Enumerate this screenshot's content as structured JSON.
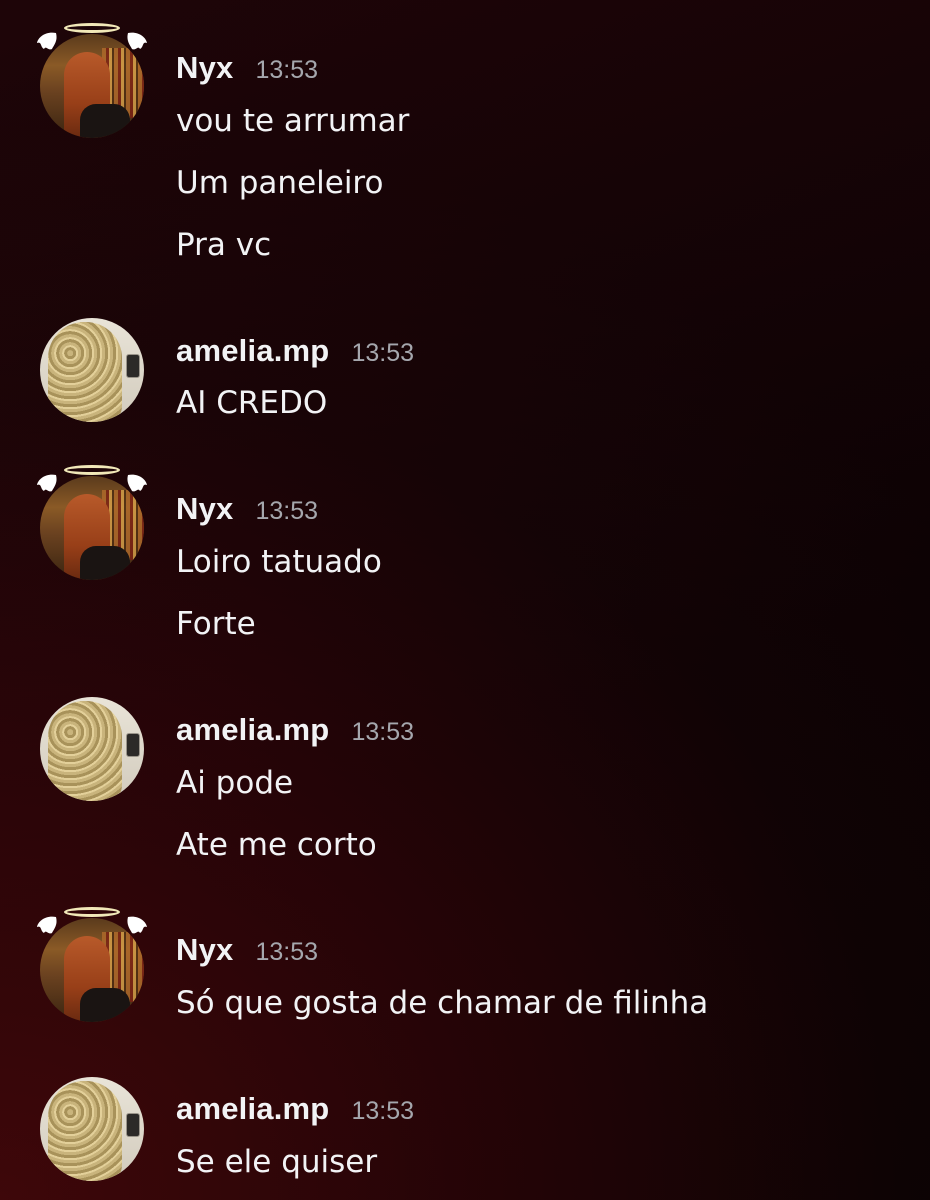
{
  "messages": [
    {
      "username": "Nyx",
      "time": "13:53",
      "lines": [
        "vou te arrumar",
        "Um paneleiro",
        "Pra vc"
      ]
    },
    {
      "username": "amelia.mp",
      "time": "13:53",
      "lines": [
        "AI CREDO"
      ]
    },
    {
      "username": "Nyx",
      "time": "13:53",
      "lines": [
        "Loiro tatuado",
        "Forte"
      ]
    },
    {
      "username": "amelia.mp",
      "time": "13:53",
      "lines": [
        "Ai pode",
        "Ate me corto"
      ]
    },
    {
      "username": "Nyx",
      "time": "13:53",
      "lines": [
        "Só que gosta de chamar de filinha"
      ]
    },
    {
      "username": "amelia.mp",
      "time": "13:53",
      "lines": [
        "Se ele quiser"
      ]
    }
  ],
  "colors": {
    "text": "#f2f3f5",
    "timestamp": "#a5a7ad",
    "background_accent": "#3a0608"
  },
  "icons": {
    "nyx_avatar_decoration": "angel-halo-wings-icon"
  }
}
